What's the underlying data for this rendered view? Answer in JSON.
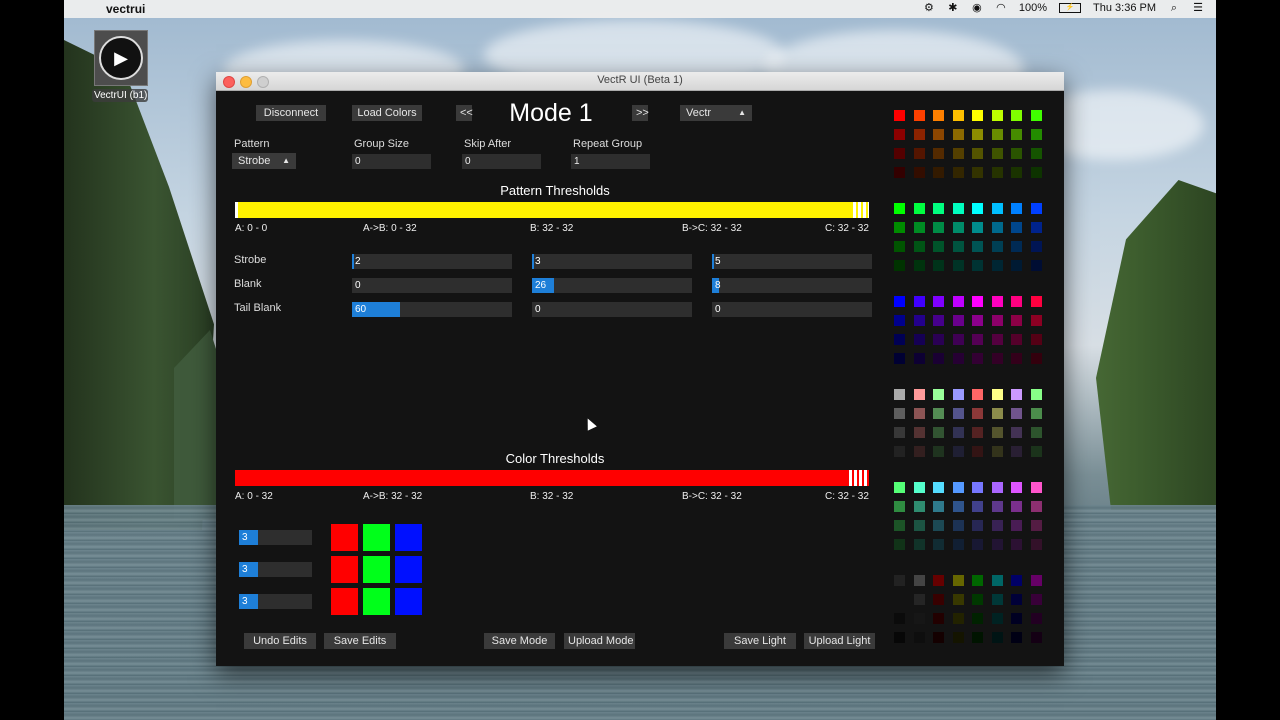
{
  "menubar": {
    "app_name": "vectrui",
    "battery": "100%",
    "clock": "Thu 3:36 PM"
  },
  "desktop_icon": {
    "label": "VectrUI (b1)"
  },
  "window": {
    "title": "VectR UI (Beta 1)"
  },
  "toolbar": {
    "disconnect": "Disconnect",
    "load_colors": "Load Colors",
    "prev": "<<",
    "next": ">>",
    "mode_title": "Mode 1",
    "device": "Vectr"
  },
  "fields": {
    "pattern_label": "Pattern",
    "pattern_value": "Strobe",
    "group_size_label": "Group Size",
    "group_size_value": "0",
    "skip_after_label": "Skip After",
    "skip_after_value": "0",
    "repeat_group_label": "Repeat Group",
    "repeat_group_value": "1"
  },
  "pattern_thresholds": {
    "title": "Pattern Thresholds",
    "bar_color": "#fff200",
    "labels": [
      "A: 0 - 0",
      "A->B: 0 - 32",
      "B: 32 - 32",
      "B->C: 32 - 32",
      "C: 32 - 32"
    ]
  },
  "params": {
    "rows": [
      {
        "label": "Strobe",
        "values": [
          "2",
          "3",
          "5"
        ]
      },
      {
        "label": "Blank",
        "values": [
          "0",
          "26",
          "8"
        ]
      },
      {
        "label": "Tail Blank",
        "values": [
          "60",
          "0",
          "0"
        ]
      }
    ]
  },
  "color_thresholds": {
    "title": "Color Thresholds",
    "bar_color": "#ff0000",
    "labels": [
      "A: 0 - 32",
      "A->B: 32 - 32",
      "B: 32 - 32",
      "B->C: 32 - 32",
      "C: 32 - 32"
    ]
  },
  "color_sets": [
    {
      "count": "3",
      "colors": [
        "#ff0000",
        "#00ff1a",
        "#0010ff"
      ]
    },
    {
      "count": "3",
      "colors": [
        "#ff0000",
        "#00ff1a",
        "#0010ff"
      ]
    },
    {
      "count": "3",
      "colors": [
        "#ff0000",
        "#00ff1a",
        "#0010ff"
      ]
    }
  ],
  "footer": {
    "undo_edits": "Undo Edits",
    "save_edits": "Save Edits",
    "save_mode": "Save Mode",
    "upload_mode": "Upload Mode",
    "save_light": "Save Light",
    "upload_light": "Upload Light"
  },
  "palette_top_rows": [
    [
      "#ff0000",
      "#ff4000",
      "#ff8000",
      "#ffbf00",
      "#ffff00",
      "#bfff00",
      "#80ff00",
      "#40ff00"
    ],
    [
      "#00ff00",
      "#00ff40",
      "#00ff80",
      "#00ffbf",
      "#00ffff",
      "#00bfff",
      "#0080ff",
      "#0040ff"
    ],
    [
      "#0000ff",
      "#4000ff",
      "#8000ff",
      "#bf00ff",
      "#ff00ff",
      "#ff00bf",
      "#ff0080",
      "#ff0040"
    ],
    [
      "#aaaaaa",
      "#ff9999",
      "#99ff99",
      "#9999ff",
      "#ff6666",
      "#ffff88",
      "#cc99ff",
      "#88ff88"
    ],
    [
      "#55ff77",
      "#55ffcc",
      "#55ddff",
      "#5599ff",
      "#7777ff",
      "#aa66ff",
      "#dd55ff",
      "#ff55cc"
    ],
    [
      "#222222",
      "#444444",
      "#660000",
      "#666600",
      "#006600",
      "#006666",
      "#000066",
      "#660066"
    ]
  ]
}
